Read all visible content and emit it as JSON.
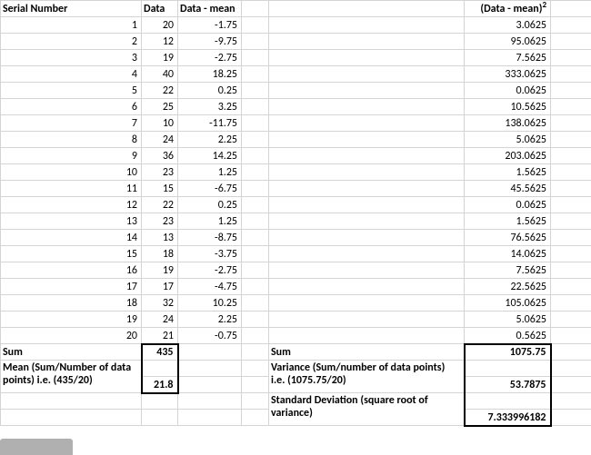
{
  "headers": {
    "serial": "Serial Number",
    "data": "Data",
    "data_mean": "Data - mean",
    "data_mean_sq": "(Data - mean)",
    "sq_sup": "2"
  },
  "rows": [
    {
      "sn": "1",
      "d": "20",
      "dm": "-1.75",
      "sq": "3.0625"
    },
    {
      "sn": "2",
      "d": "12",
      "dm": "-9.75",
      "sq": "95.0625"
    },
    {
      "sn": "3",
      "d": "19",
      "dm": "-2.75",
      "sq": "7.5625"
    },
    {
      "sn": "4",
      "d": "40",
      "dm": "18.25",
      "sq": "333.0625"
    },
    {
      "sn": "5",
      "d": "22",
      "dm": "0.25",
      "sq": "0.0625"
    },
    {
      "sn": "6",
      "d": "25",
      "dm": "3.25",
      "sq": "10.5625"
    },
    {
      "sn": "7",
      "d": "10",
      "dm": "-11.75",
      "sq": "138.0625"
    },
    {
      "sn": "8",
      "d": "24",
      "dm": "2.25",
      "sq": "5.0625"
    },
    {
      "sn": "9",
      "d": "36",
      "dm": "14.25",
      "sq": "203.0625"
    },
    {
      "sn": "10",
      "d": "23",
      "dm": "1.25",
      "sq": "1.5625"
    },
    {
      "sn": "11",
      "d": "15",
      "dm": "-6.75",
      "sq": "45.5625"
    },
    {
      "sn": "12",
      "d": "22",
      "dm": "0.25",
      "sq": "0.0625"
    },
    {
      "sn": "13",
      "d": "23",
      "dm": "1.25",
      "sq": "1.5625"
    },
    {
      "sn": "14",
      "d": "13",
      "dm": "-8.75",
      "sq": "76.5625"
    },
    {
      "sn": "15",
      "d": "18",
      "dm": "-3.75",
      "sq": "14.0625"
    },
    {
      "sn": "16",
      "d": "19",
      "dm": "-2.75",
      "sq": "7.5625"
    },
    {
      "sn": "17",
      "d": "17",
      "dm": "-4.75",
      "sq": "22.5625"
    },
    {
      "sn": "18",
      "d": "32",
      "dm": "10.25",
      "sq": "105.0625"
    },
    {
      "sn": "19",
      "d": "24",
      "dm": "2.25",
      "sq": "5.0625"
    },
    {
      "sn": "20",
      "d": "21",
      "dm": "-0.75",
      "sq": "0.5625"
    }
  ],
  "summary": {
    "sum_label": "Sum",
    "sum_data": "435",
    "sum_sq_label": "Sum",
    "sum_sq": "1075.75",
    "mean_label": "Mean (Sum/Number of data points) i.e. (435/20)",
    "mean": "21.8",
    "var_label": "Variance (Sum/number of data points) i.e. (1075.75/20)",
    "var": "53.7875",
    "sd_label": "Standard Deviation (square root of variance)",
    "sd": "7.333996182"
  },
  "chart_data": {
    "type": "table",
    "title": "Variance / Standard Deviation worksheet",
    "n": 20,
    "data": [
      20,
      12,
      19,
      40,
      22,
      25,
      10,
      24,
      36,
      23,
      15,
      22,
      23,
      13,
      18,
      19,
      17,
      32,
      24,
      21
    ],
    "deviation_from_mean": [
      -1.75,
      -9.75,
      -2.75,
      18.25,
      0.25,
      3.25,
      -11.75,
      2.25,
      14.25,
      1.25,
      -6.75,
      0.25,
      1.25,
      -8.75,
      -3.75,
      -2.75,
      -4.75,
      10.25,
      2.25,
      -0.75
    ],
    "squared_deviation": [
      3.0625,
      95.0625,
      7.5625,
      333.0625,
      0.0625,
      10.5625,
      138.0625,
      5.0625,
      203.0625,
      1.5625,
      45.5625,
      0.0625,
      1.5625,
      76.5625,
      14.0625,
      7.5625,
      22.5625,
      105.0625,
      5.0625,
      0.5625
    ],
    "sum": 435,
    "mean": 21.8,
    "sum_squared_deviation": 1075.75,
    "variance": 53.7875,
    "standard_deviation": 7.333996182
  }
}
